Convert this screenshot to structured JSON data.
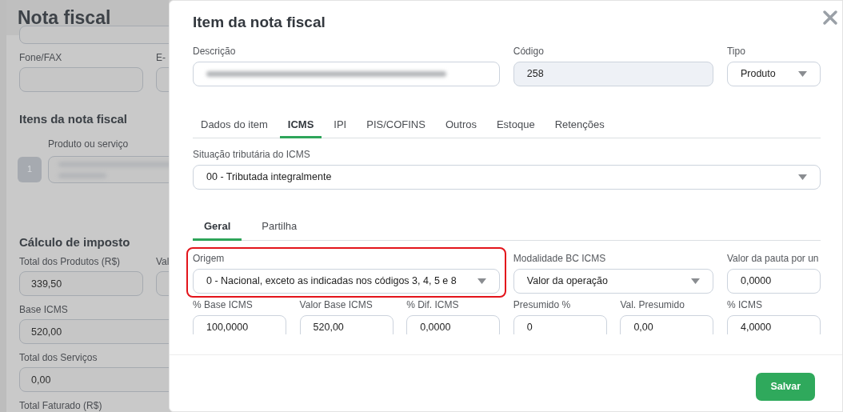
{
  "background_page": {
    "title": "Nota fiscal",
    "contact_fields": [
      {
        "label": "Fone/FAX"
      },
      {
        "label": "E-"
      }
    ],
    "items_heading": "Itens da nota fiscal",
    "item_column": "Produto ou serviço",
    "item_rows": [
      {
        "number": "1",
        "blurred": true
      }
    ],
    "tax_heading": "Cálculo de imposto",
    "tax_rows": [
      [
        {
          "kind": "input",
          "label": "Total dos Produtos (R$)",
          "value": "339,50"
        },
        {
          "kind": "input",
          "label": "Val"
        }
      ],
      [
        {
          "kind": "input",
          "label": "Base ICMS",
          "value": "520,00"
        }
      ],
      [
        {
          "kind": "input",
          "label": "Total dos Serviços",
          "value": "0,00"
        }
      ],
      [
        {
          "kind": "label",
          "label": "Total Faturado (R$)"
        }
      ]
    ]
  },
  "modal": {
    "title": "Item da nota fiscal",
    "header_fields": [
      {
        "kind": "input",
        "label": "Descrição",
        "blurred": true
      },
      {
        "kind": "input",
        "label": "Código",
        "value": "258",
        "disabled": true
      },
      {
        "kind": "select",
        "label": "Tipo",
        "value": "Produto"
      }
    ],
    "tabs": [
      {
        "label": "Dados do item",
        "selected": false
      },
      {
        "label": "ICMS",
        "selected": true
      },
      {
        "label": "IPI",
        "selected": false
      },
      {
        "label": "PIS/COFINS",
        "selected": false
      },
      {
        "label": "Outros",
        "selected": false
      },
      {
        "label": "Estoque",
        "selected": false
      },
      {
        "label": "Retenções",
        "selected": false
      }
    ],
    "situacao": {
      "label": "Situação tributária do ICMS",
      "value": "00 - Tributada integralmente"
    },
    "subtabs": [
      {
        "label": "Geral",
        "selected": true
      },
      {
        "label": "Partilha",
        "selected": false
      }
    ],
    "fields": [
      {
        "kind": "select",
        "label": "Origem",
        "value": "0 - Nacional, exceto as indicadas nos códigos 3, 4, 5 e 8",
        "highlighted": true
      },
      {
        "kind": "select",
        "label": "Modalidade BC ICMS",
        "value": "Valor da operação",
        "highlighted": false
      },
      {
        "kind": "input",
        "label": "Valor da pauta por un",
        "value": "0,0000",
        "highlighted": false
      },
      {
        "kind": "input",
        "label": "% Base ICMS",
        "value": "100,0000",
        "highlighted": false
      },
      {
        "kind": "input",
        "label": "Valor Base ICMS",
        "value": "520,00",
        "highlighted": false
      },
      {
        "kind": "input",
        "label": "% Dif. ICMS",
        "value": "0,0000",
        "highlighted": false
      },
      {
        "kind": "input",
        "label": "Presumido %",
        "value": "0",
        "highlighted": false
      },
      {
        "kind": "input",
        "label": "Val. Presumido",
        "value": "0,00",
        "highlighted": false
      },
      {
        "kind": "input",
        "label": "% ICMS",
        "value": "4,0000",
        "highlighted": false
      }
    ],
    "save_button": "Salvar"
  }
}
